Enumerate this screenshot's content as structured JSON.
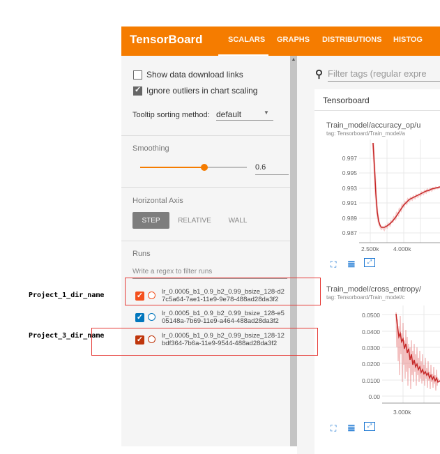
{
  "header": {
    "title": "TensorBoard",
    "tabs": [
      {
        "label": "SCALARS"
      },
      {
        "label": "GRAPHS"
      },
      {
        "label": "DISTRIBUTIONS"
      },
      {
        "label": "HISTOG"
      }
    ]
  },
  "sidebar": {
    "show_download_links": {
      "label": "Show data download links",
      "checked": false
    },
    "ignore_outliers": {
      "label": "Ignore outliers in chart scaling",
      "checked": true
    },
    "tooltip_sorting": {
      "label": "Tooltip sorting method:",
      "value": "default"
    },
    "smoothing": {
      "label": "Smoothing",
      "value": "0.6",
      "level": 0.6
    },
    "horizontal_axis": {
      "label": "Horizontal Axis",
      "options": [
        "STEP",
        "RELATIVE",
        "WALL"
      ],
      "selected": "STEP"
    },
    "runs": {
      "label": "Runs",
      "filter_placeholder": "Write a regex to filter runs",
      "items": [
        {
          "line1": "lr_0.0005_b1_0.9_b2_0.99_bsize_128-d2",
          "line2": "7c5a64-7ae1-11e9-9e78-488ad28da3f2",
          "checked": true,
          "color": "#f4511e"
        },
        {
          "line1": "lr_0.0005_b1_0.9_b2_0.99_bsize_128-e5",
          "line2": "05148a-7b69-11e9-a464-488ad28da3f2",
          "checked": true,
          "color": "#0277bd"
        },
        {
          "line1": "lr_0.0005_b1_0.9_b2_0.99_bsize_128-12",
          "line2": "bdf364-7b6a-11e9-9544-488ad28da3f2",
          "checked": true,
          "color": "#bf360c"
        }
      ]
    }
  },
  "main": {
    "filter_placeholder": "Filter tags (regular expre",
    "group_title": "Tensorboard",
    "charts": [
      {
        "title": "Train_model/accuracy_op/u",
        "tag": "tag: Tensorboard/Train_model/a",
        "y_ticks": [
          "0.997",
          "0.995",
          "0.993",
          "0.991",
          "0.989",
          "0.987"
        ],
        "x_ticks": [
          "2.500k",
          "4.000k"
        ]
      },
      {
        "title": "Train_model/cross_entropy/",
        "tag": "tag: Tensorboard/Train_model/c",
        "y_ticks": [
          "0.0500",
          "0.0400",
          "0.0300",
          "0.0200",
          "0.0100",
          "0.00"
        ],
        "x_ticks": [
          "3.000k"
        ]
      }
    ]
  },
  "annotations": {
    "label1": "Project_1_dir_name",
    "label3": "Project_3_dir_name"
  },
  "colors": {
    "header": "#f57c00",
    "chart_line": "#c62828",
    "annotation_box": "#e53935"
  }
}
